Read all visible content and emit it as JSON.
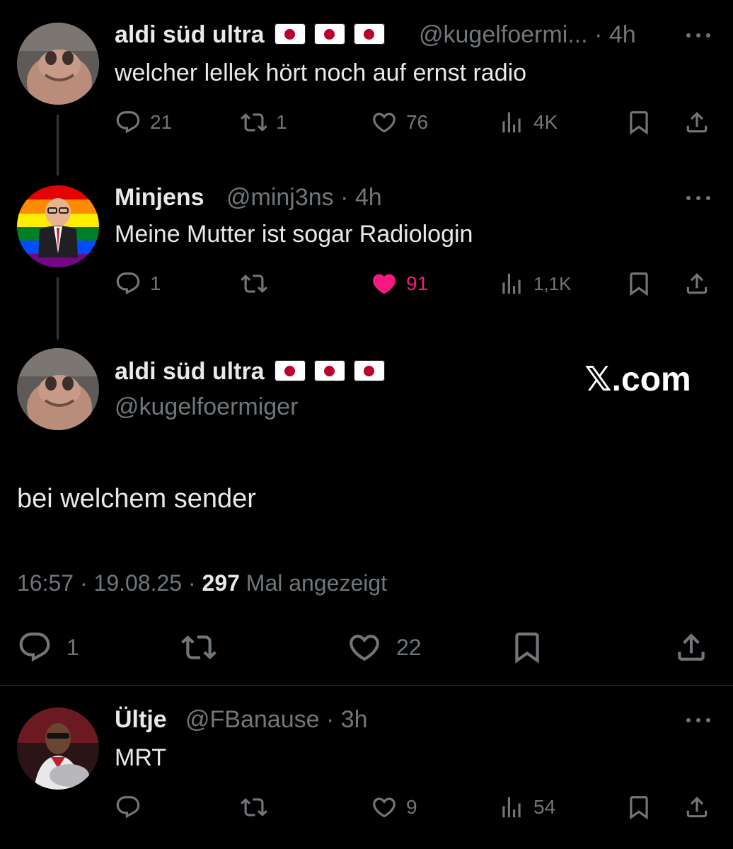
{
  "tweet1": {
    "name": "aldi süd ultra",
    "handle": "@kugelfoermi...",
    "time": "· 4h",
    "text": "welcher lellek hört noch auf ernst radio",
    "replies": "21",
    "retweets": "1",
    "likes": "76",
    "views": "4K"
  },
  "tweet2": {
    "name": "Minjens",
    "handle": "@minj3ns",
    "time": "· 4h",
    "text": "Meine Mutter ist sogar Radiologin",
    "replies": "1",
    "retweets": "",
    "likes": "91",
    "views": "1,1K",
    "liked": true,
    "like_color": "#f91880"
  },
  "main": {
    "name": "aldi süd ultra",
    "handle": "@kugelfoermiger",
    "brand": "𝕏.com",
    "text": "bei welchem sender",
    "timestamp": "16:57 · 19.08.25 ·",
    "views_count": "297",
    "views_label": "Mal angezeigt",
    "replies": "1",
    "likes": "22"
  },
  "tweet4": {
    "name": "Ültje",
    "handle": "@FBanause",
    "time": "· 3h",
    "text": "MRT",
    "likes": "9",
    "views": "54"
  },
  "icons": [
    "reply-icon",
    "retweet-icon",
    "like-icon",
    "views-icon",
    "bookmark-icon",
    "share-icon",
    "more-icon",
    "flag-japan-icon"
  ]
}
